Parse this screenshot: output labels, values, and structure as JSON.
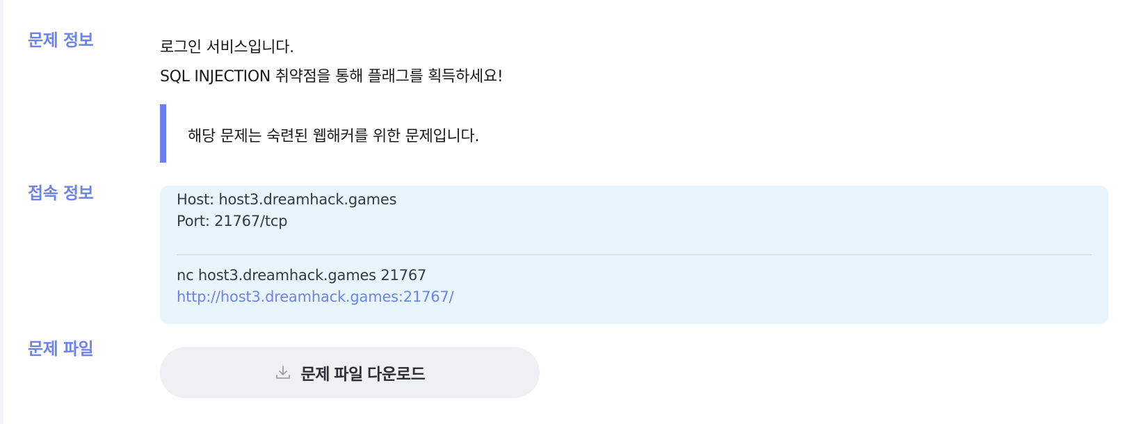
{
  "problem_info": {
    "label": "문제 정보",
    "description_lines": [
      "로그인 서비스입니다.",
      "SQL INJECTION 취약점을 통해 플래그를 획득하세요!"
    ],
    "note": "해당 문제는 숙련된 웹해커를 위한 문제입니다."
  },
  "connection_info": {
    "label": "접속 정보",
    "host": "Host: host3.dreamhack.games",
    "port": "Port: 21767/tcp",
    "nc_command": "nc host3.dreamhack.games 21767",
    "url": "http://host3.dreamhack.games:21767/"
  },
  "problem_file": {
    "label": "문제 파일",
    "download_label": "문제 파일 다운로드",
    "download_icon": "download-icon"
  },
  "colors": {
    "accent": "#6d83ec",
    "quote_bar": "#6d7ff0",
    "connection_bg": "#e8f5fc",
    "button_bg": "#eff0f3"
  }
}
